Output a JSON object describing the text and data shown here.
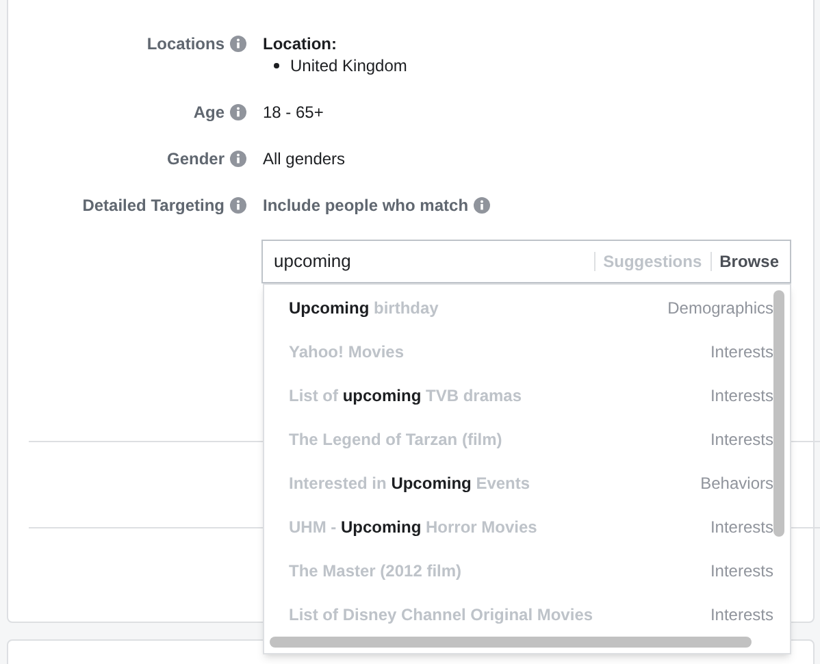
{
  "fields": [
    {
      "label": "Locations",
      "kind": "location",
      "heading": "Location:",
      "items": [
        "United Kingdom"
      ]
    },
    {
      "label": "Age",
      "kind": "text",
      "value": "18 - 65+"
    },
    {
      "label": "Gender",
      "kind": "text",
      "value": "All genders"
    },
    {
      "label": "Detailed Targeting",
      "kind": "targeting",
      "heading": "Include people who match"
    }
  ],
  "search": {
    "value": "upcoming",
    "tabs": [
      {
        "label": "Suggestions",
        "selected": false
      },
      {
        "label": "Browse",
        "selected": true
      }
    ]
  },
  "results": [
    {
      "name": "**Upcoming** birthday",
      "category": "Demographics"
    },
    {
      "name": "Yahoo! Movies",
      "category": "Interests"
    },
    {
      "name": "List of **upcoming** TVB dramas",
      "category": "Interests"
    },
    {
      "name": "The Legend of Tarzan (film)",
      "category": "Interests"
    },
    {
      "name": "Interested in **Upcoming** Events",
      "category": "Behaviors"
    },
    {
      "name": "UHM - **Upcoming** Horror Movies",
      "category": "Interests"
    },
    {
      "name": "The Master (2012 film)",
      "category": "Interests"
    },
    {
      "name": "List of Disney Channel Original Movies",
      "category": "Interests"
    }
  ]
}
